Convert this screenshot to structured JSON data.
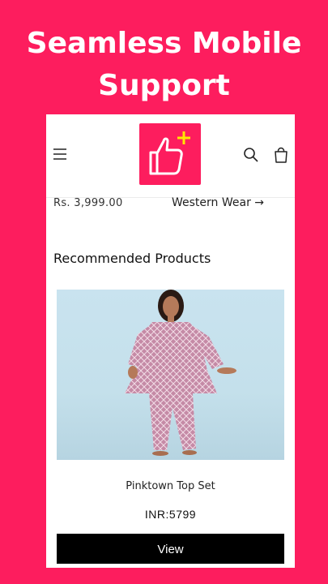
{
  "promo": {
    "line1": "Seamless Mobile",
    "line2": "Support"
  },
  "header": {
    "menu_icon": "hamburger-menu-icon",
    "logo_icon": "thumbs-up-plus-logo",
    "search_icon": "search-icon",
    "cart_icon": "shopping-bag-icon",
    "brand_color": "#fd1d5e",
    "logo_plus_color": "#ffe600"
  },
  "prev_product": {
    "price": "Rs. 3,999.00"
  },
  "collection_link": {
    "label": "Western Wear",
    "arrow": "→"
  },
  "recommended": {
    "title": "Recommended Products",
    "products": [
      {
        "name": "Pinktown Top Set",
        "price": "INR:5799",
        "button_label": "View"
      }
    ]
  }
}
